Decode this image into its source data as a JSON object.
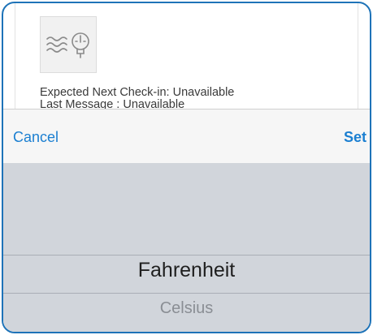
{
  "device": {
    "icon": "thermostat-sensor-icon",
    "expected_next_checkin": "Expected Next Check-in: Unavailable",
    "last_message": "Last Message : Unavailable"
  },
  "picker": {
    "cancel_label": "Cancel",
    "set_label": "Set",
    "options": [
      "Fahrenheit",
      "Celsius"
    ],
    "selected": "Fahrenheit"
  },
  "colors": {
    "frame_border": "#1e73b8",
    "action_blue": "#1b7fd1",
    "picker_background": "#d1d5db"
  }
}
